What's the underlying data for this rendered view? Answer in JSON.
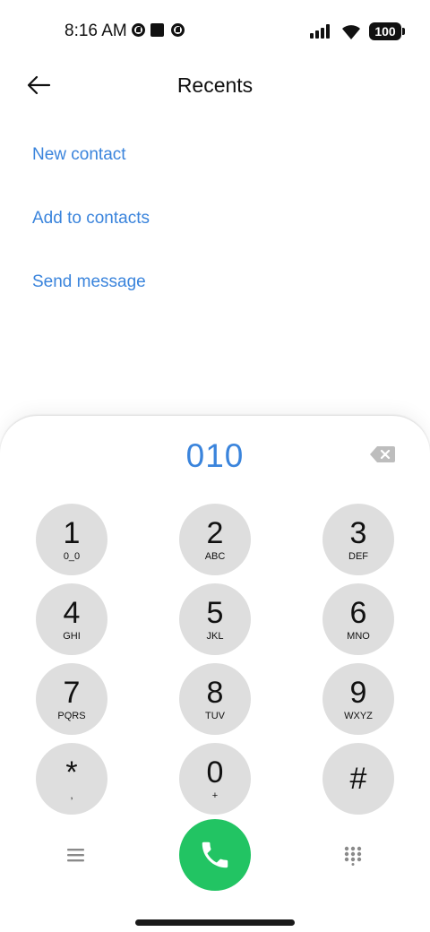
{
  "status_bar": {
    "time": "8:16 AM",
    "battery": "100"
  },
  "header": {
    "title": "Recents",
    "back_icon": "arrow-left-icon"
  },
  "actions": [
    {
      "label": "New contact"
    },
    {
      "label": "Add to contacts"
    },
    {
      "label": "Send message"
    }
  ],
  "dialpad": {
    "number": "010",
    "keys": [
      {
        "digit": "1",
        "letters": "0_0"
      },
      {
        "digit": "2",
        "letters": "ABC"
      },
      {
        "digit": "3",
        "letters": "DEF"
      },
      {
        "digit": "4",
        "letters": "GHI"
      },
      {
        "digit": "5",
        "letters": "JKL"
      },
      {
        "digit": "6",
        "letters": "MNO"
      },
      {
        "digit": "7",
        "letters": "PQRS"
      },
      {
        "digit": "8",
        "letters": "TUV"
      },
      {
        "digit": "9",
        "letters": "WXYZ"
      },
      {
        "digit": "*",
        "letters": ","
      },
      {
        "digit": "0",
        "letters": "+"
      },
      {
        "digit": "#",
        "letters": ""
      }
    ]
  },
  "colors": {
    "accent": "#3a84dc",
    "call": "#22c463",
    "key_bg": "#dedede"
  }
}
